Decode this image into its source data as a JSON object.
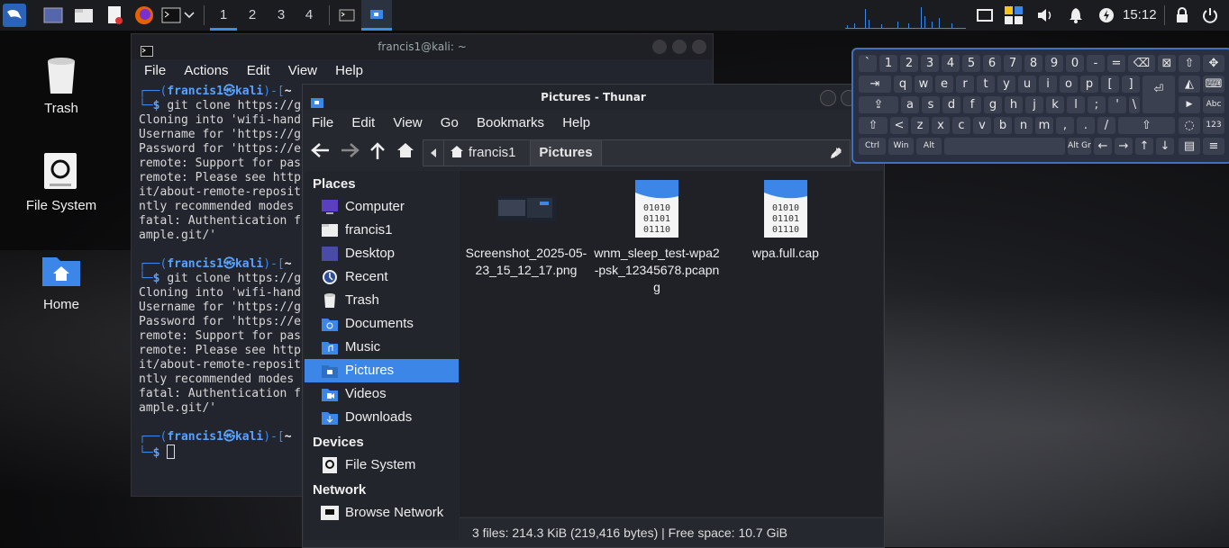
{
  "taskbar": {
    "workspaces": [
      "1",
      "2",
      "3",
      "4"
    ],
    "active_workspace": "1",
    "clock": "15:12"
  },
  "desktop": {
    "icons": [
      {
        "label": "Trash",
        "icon": "trash-icon"
      },
      {
        "label": "File System",
        "icon": "drive-icon"
      },
      {
        "label": "Home",
        "icon": "home-folder-icon"
      }
    ]
  },
  "terminal": {
    "title": "francis1@kali: ~",
    "menu": [
      "File",
      "Actions",
      "Edit",
      "View",
      "Help"
    ],
    "blocks": [
      {
        "user": "francis1",
        "host": "kali",
        "dir": "~",
        "command": "git clone https://g",
        "output": [
          "Cloning into 'wifi-hand",
          "Username for 'https://g",
          "Password for 'https://e",
          "remote: Support for pas",
          "remote: Please see http",
          "it/about-remote-reposit",
          "ntly recommended modes ",
          "fatal: Authentication f",
          "ample.git/'"
        ]
      },
      {
        "user": "francis1",
        "host": "kali",
        "dir": "~",
        "command": "git clone https://g",
        "output": [
          "Cloning into 'wifi-hand",
          "Username for 'https://g",
          "Password for 'https://e",
          "remote: Support for pas",
          "remote: Please see http",
          "it/about-remote-reposit",
          "ntly recommended modes ",
          "fatal: Authentication f",
          "ample.git/'"
        ]
      }
    ],
    "final_prompt": {
      "user": "francis1",
      "host": "kali",
      "dir": "~"
    }
  },
  "thunar": {
    "title": "Pictures - Thunar",
    "menu": [
      "File",
      "Edit",
      "View",
      "Go",
      "Bookmarks",
      "Help"
    ],
    "breadcrumbs": [
      "francis1",
      "Pictures"
    ],
    "sidebar": {
      "places_header": "Places",
      "places": [
        {
          "label": "Computer",
          "icon": "computer-icon"
        },
        {
          "label": "francis1",
          "icon": "home-icon"
        },
        {
          "label": "Desktop",
          "icon": "desktop-icon"
        },
        {
          "label": "Recent",
          "icon": "recent-icon"
        },
        {
          "label": "Trash",
          "icon": "trash-icon"
        },
        {
          "label": "Documents",
          "icon": "documents-folder-icon"
        },
        {
          "label": "Music",
          "icon": "music-folder-icon"
        },
        {
          "label": "Pictures",
          "icon": "pictures-folder-icon",
          "selected": true
        },
        {
          "label": "Videos",
          "icon": "videos-folder-icon"
        },
        {
          "label": "Downloads",
          "icon": "downloads-folder-icon"
        }
      ],
      "devices_header": "Devices",
      "devices": [
        {
          "label": "File System",
          "icon": "drive-icon"
        }
      ],
      "network_header": "Network",
      "network": [
        {
          "label": "Browse Network",
          "icon": "network-icon"
        }
      ]
    },
    "files": [
      {
        "name": "Screenshot_2025-05-23_15_12_17.png",
        "icon": "image-thumbnail-icon"
      },
      {
        "name": "wnm_sleep_test-wpa2-psk_12345678.pcapng",
        "icon": "binary-file-icon"
      },
      {
        "name": "wpa.full.cap",
        "icon": "binary-file-icon"
      }
    ],
    "binary_icon_text": [
      "01010",
      "01101",
      "01110"
    ],
    "status": "3 files: 214.3 KiB (219,416 bytes) | Free space: 10.7 GiB"
  },
  "keyboard": {
    "rows": [
      [
        "`",
        "1",
        "2",
        "3",
        "4",
        "5",
        "6",
        "7",
        "8",
        "9",
        "0",
        "-",
        "="
      ],
      [
        "q",
        "w",
        "e",
        "r",
        "t",
        "y",
        "u",
        "i",
        "o",
        "p",
        "[",
        "]"
      ],
      [
        "a",
        "s",
        "d",
        "f",
        "g",
        "h",
        "j",
        "k",
        "l",
        ";",
        "'",
        "\\"
      ],
      [
        "<",
        "z",
        "x",
        "c",
        "v",
        "b",
        "n",
        "m",
        ",",
        ".",
        "/"
      ]
    ],
    "modifiers": [
      "Ctrl",
      "Win",
      "Alt",
      "Alt Gr"
    ],
    "side_keys": [
      "Abc",
      "123"
    ]
  }
}
